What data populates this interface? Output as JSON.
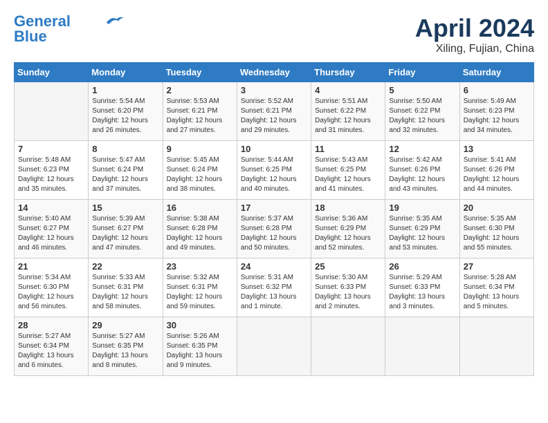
{
  "header": {
    "logo_line1": "General",
    "logo_line2": "Blue",
    "month_title": "April 2024",
    "location": "Xiling, Fujian, China"
  },
  "weekdays": [
    "Sunday",
    "Monday",
    "Tuesday",
    "Wednesday",
    "Thursday",
    "Friday",
    "Saturday"
  ],
  "weeks": [
    [
      {
        "day": "",
        "sunrise": "",
        "sunset": "",
        "daylight": ""
      },
      {
        "day": "1",
        "sunrise": "Sunrise: 5:54 AM",
        "sunset": "Sunset: 6:20 PM",
        "daylight": "Daylight: 12 hours and 26 minutes."
      },
      {
        "day": "2",
        "sunrise": "Sunrise: 5:53 AM",
        "sunset": "Sunset: 6:21 PM",
        "daylight": "Daylight: 12 hours and 27 minutes."
      },
      {
        "day": "3",
        "sunrise": "Sunrise: 5:52 AM",
        "sunset": "Sunset: 6:21 PM",
        "daylight": "Daylight: 12 hours and 29 minutes."
      },
      {
        "day": "4",
        "sunrise": "Sunrise: 5:51 AM",
        "sunset": "Sunset: 6:22 PM",
        "daylight": "Daylight: 12 hours and 31 minutes."
      },
      {
        "day": "5",
        "sunrise": "Sunrise: 5:50 AM",
        "sunset": "Sunset: 6:22 PM",
        "daylight": "Daylight: 12 hours and 32 minutes."
      },
      {
        "day": "6",
        "sunrise": "Sunrise: 5:49 AM",
        "sunset": "Sunset: 6:23 PM",
        "daylight": "Daylight: 12 hours and 34 minutes."
      }
    ],
    [
      {
        "day": "7",
        "sunrise": "Sunrise: 5:48 AM",
        "sunset": "Sunset: 6:23 PM",
        "daylight": "Daylight: 12 hours and 35 minutes."
      },
      {
        "day": "8",
        "sunrise": "Sunrise: 5:47 AM",
        "sunset": "Sunset: 6:24 PM",
        "daylight": "Daylight: 12 hours and 37 minutes."
      },
      {
        "day": "9",
        "sunrise": "Sunrise: 5:45 AM",
        "sunset": "Sunset: 6:24 PM",
        "daylight": "Daylight: 12 hours and 38 minutes."
      },
      {
        "day": "10",
        "sunrise": "Sunrise: 5:44 AM",
        "sunset": "Sunset: 6:25 PM",
        "daylight": "Daylight: 12 hours and 40 minutes."
      },
      {
        "day": "11",
        "sunrise": "Sunrise: 5:43 AM",
        "sunset": "Sunset: 6:25 PM",
        "daylight": "Daylight: 12 hours and 41 minutes."
      },
      {
        "day": "12",
        "sunrise": "Sunrise: 5:42 AM",
        "sunset": "Sunset: 6:26 PM",
        "daylight": "Daylight: 12 hours and 43 minutes."
      },
      {
        "day": "13",
        "sunrise": "Sunrise: 5:41 AM",
        "sunset": "Sunset: 6:26 PM",
        "daylight": "Daylight: 12 hours and 44 minutes."
      }
    ],
    [
      {
        "day": "14",
        "sunrise": "Sunrise: 5:40 AM",
        "sunset": "Sunset: 6:27 PM",
        "daylight": "Daylight: 12 hours and 46 minutes."
      },
      {
        "day": "15",
        "sunrise": "Sunrise: 5:39 AM",
        "sunset": "Sunset: 6:27 PM",
        "daylight": "Daylight: 12 hours and 47 minutes."
      },
      {
        "day": "16",
        "sunrise": "Sunrise: 5:38 AM",
        "sunset": "Sunset: 6:28 PM",
        "daylight": "Daylight: 12 hours and 49 minutes."
      },
      {
        "day": "17",
        "sunrise": "Sunrise: 5:37 AM",
        "sunset": "Sunset: 6:28 PM",
        "daylight": "Daylight: 12 hours and 50 minutes."
      },
      {
        "day": "18",
        "sunrise": "Sunrise: 5:36 AM",
        "sunset": "Sunset: 6:29 PM",
        "daylight": "Daylight: 12 hours and 52 minutes."
      },
      {
        "day": "19",
        "sunrise": "Sunrise: 5:35 AM",
        "sunset": "Sunset: 6:29 PM",
        "daylight": "Daylight: 12 hours and 53 minutes."
      },
      {
        "day": "20",
        "sunrise": "Sunrise: 5:35 AM",
        "sunset": "Sunset: 6:30 PM",
        "daylight": "Daylight: 12 hours and 55 minutes."
      }
    ],
    [
      {
        "day": "21",
        "sunrise": "Sunrise: 5:34 AM",
        "sunset": "Sunset: 6:30 PM",
        "daylight": "Daylight: 12 hours and 56 minutes."
      },
      {
        "day": "22",
        "sunrise": "Sunrise: 5:33 AM",
        "sunset": "Sunset: 6:31 PM",
        "daylight": "Daylight: 12 hours and 58 minutes."
      },
      {
        "day": "23",
        "sunrise": "Sunrise: 5:32 AM",
        "sunset": "Sunset: 6:31 PM",
        "daylight": "Daylight: 12 hours and 59 minutes."
      },
      {
        "day": "24",
        "sunrise": "Sunrise: 5:31 AM",
        "sunset": "Sunset: 6:32 PM",
        "daylight": "Daylight: 13 hours and 1 minute."
      },
      {
        "day": "25",
        "sunrise": "Sunrise: 5:30 AM",
        "sunset": "Sunset: 6:33 PM",
        "daylight": "Daylight: 13 hours and 2 minutes."
      },
      {
        "day": "26",
        "sunrise": "Sunrise: 5:29 AM",
        "sunset": "Sunset: 6:33 PM",
        "daylight": "Daylight: 13 hours and 3 minutes."
      },
      {
        "day": "27",
        "sunrise": "Sunrise: 5:28 AM",
        "sunset": "Sunset: 6:34 PM",
        "daylight": "Daylight: 13 hours and 5 minutes."
      }
    ],
    [
      {
        "day": "28",
        "sunrise": "Sunrise: 5:27 AM",
        "sunset": "Sunset: 6:34 PM",
        "daylight": "Daylight: 13 hours and 6 minutes."
      },
      {
        "day": "29",
        "sunrise": "Sunrise: 5:27 AM",
        "sunset": "Sunset: 6:35 PM",
        "daylight": "Daylight: 13 hours and 8 minutes."
      },
      {
        "day": "30",
        "sunrise": "Sunrise: 5:26 AM",
        "sunset": "Sunset: 6:35 PM",
        "daylight": "Daylight: 13 hours and 9 minutes."
      },
      {
        "day": "",
        "sunrise": "",
        "sunset": "",
        "daylight": ""
      },
      {
        "day": "",
        "sunrise": "",
        "sunset": "",
        "daylight": ""
      },
      {
        "day": "",
        "sunrise": "",
        "sunset": "",
        "daylight": ""
      },
      {
        "day": "",
        "sunrise": "",
        "sunset": "",
        "daylight": ""
      }
    ]
  ]
}
